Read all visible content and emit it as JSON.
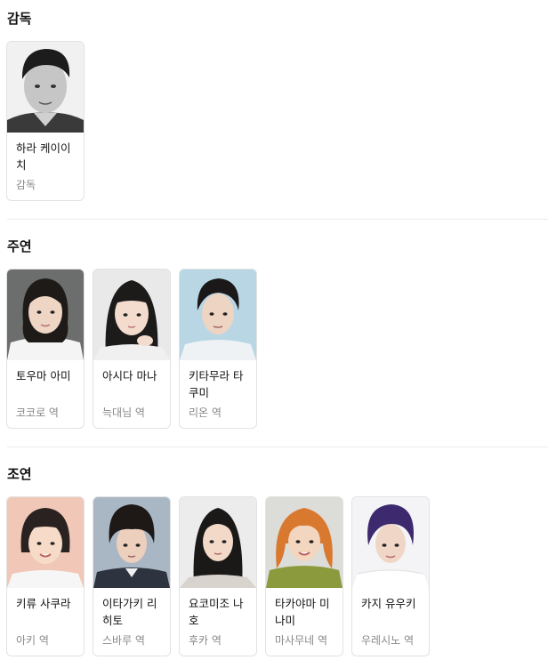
{
  "sections": [
    {
      "title": "감독",
      "people": [
        {
          "name": "하라 케이이치",
          "role": "감독",
          "photo": "director-photo-bw"
        }
      ]
    },
    {
      "title": "주연",
      "people": [
        {
          "name": "토우마 아미",
          "role": "코코로 역",
          "photo": "portrait-female-dark-hair"
        },
        {
          "name": "아시다 마나",
          "role": "늑대님 역",
          "photo": "portrait-female-bangs"
        },
        {
          "name": "키타무라 타쿠미",
          "role": "리온 역",
          "photo": "portrait-male-blue-bg"
        }
      ]
    },
    {
      "title": "조연",
      "people": [
        {
          "name": "키류 사쿠라",
          "role": "아키 역",
          "photo": "portrait-female-short-bob"
        },
        {
          "name": "이타가키 리히토",
          "role": "스바루 역",
          "photo": "portrait-male-mushroom"
        },
        {
          "name": "요코미조 나호",
          "role": "후카 역",
          "photo": "portrait-female-long-black"
        },
        {
          "name": "타카야마 미나미",
          "role": "마사무네 역",
          "photo": "portrait-female-orange-hair"
        },
        {
          "name": "카지 유우키",
          "role": "우레시노 역",
          "photo": "portrait-male-purple-hair"
        }
      ]
    }
  ]
}
